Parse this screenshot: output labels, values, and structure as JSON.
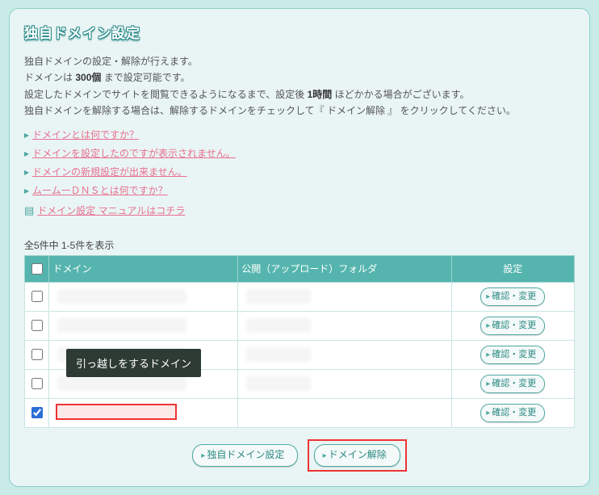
{
  "title": "独自ドメイン設定",
  "intro": {
    "l1": "独自ドメインの設定・解除が行えます。",
    "l2a": "ドメインは ",
    "l2b": "300個",
    "l2c": " まで設定可能です。",
    "l3a": "設定したドメインでサイトを閲覧できるようになるまで、設定後 ",
    "l3b": "1時間",
    "l3c": " ほどかかる場合がございます。",
    "l4": "独自ドメインを解除する場合は、解除するドメインをチェックして『 ドメイン解除 』 をクリックしてください。"
  },
  "faq": [
    "ドメインとは何ですか？",
    "ドメインを設定したのですが表示されません。",
    "ドメインの新規設定が出来ません。",
    "ムームーＤＮＳとは何ですか？"
  ],
  "manual": "ドメイン設定 マニュアルはコチラ",
  "count_line": "全5件中 1-5件を表示",
  "table": {
    "headers": {
      "domain": "ドメイン",
      "folder": "公開（アップロード）フォルダ",
      "action": "設定"
    },
    "action_label": "確認・変更",
    "rows": [
      {
        "checked": false
      },
      {
        "checked": false
      },
      {
        "checked": false
      },
      {
        "checked": false
      },
      {
        "checked": true,
        "highlight": true
      }
    ]
  },
  "tooltip": "引っ越しをするドメイン",
  "buttons": {
    "add": "独自ドメイン設定",
    "remove": "ドメイン解除"
  }
}
